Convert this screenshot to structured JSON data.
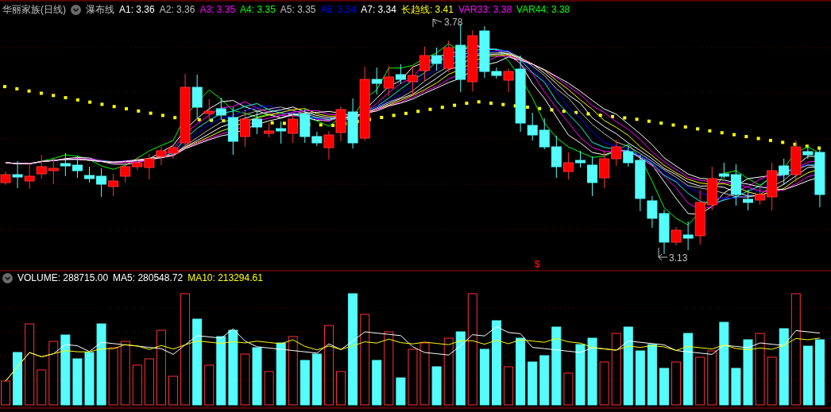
{
  "indicator_header": {
    "stock": "华丽家族(日线)",
    "indicator": "瀑布线",
    "values": [
      {
        "text": "A1: 3.36",
        "color": "#ffffff"
      },
      {
        "text": "A2: 3.36",
        "color": "#c0c0c0"
      },
      {
        "text": "A3: 3.35",
        "color": "#ff00ff"
      },
      {
        "text": "A4: 3.35",
        "color": "#00ff00"
      },
      {
        "text": "A5: 3.35",
        "color": "#c0c0c0"
      },
      {
        "text": "A6: 3.34",
        "color": "#0000ff"
      },
      {
        "text": "A7: 3.34",
        "color": "#ffffff"
      },
      {
        "text": "长趋线: 3.41",
        "color": "#ffff00"
      },
      {
        "text": "VAR33: 3.38",
        "color": "#ff00ff"
      },
      {
        "text": "VAR44: 3.38",
        "color": "#00ff00"
      }
    ]
  },
  "price_chart": {
    "high_label": "3.78",
    "low_label": "3.13",
    "signal_mark": "$"
  },
  "volume_header": {
    "values": [
      {
        "text": "VOLUME: 288715.00",
        "color": "#ffffff"
      },
      {
        "text": "MA5: 280548.72",
        "color": "#ffffff"
      },
      {
        "text": "MA10: 213294.61",
        "color": "#ffff00"
      }
    ]
  }
}
